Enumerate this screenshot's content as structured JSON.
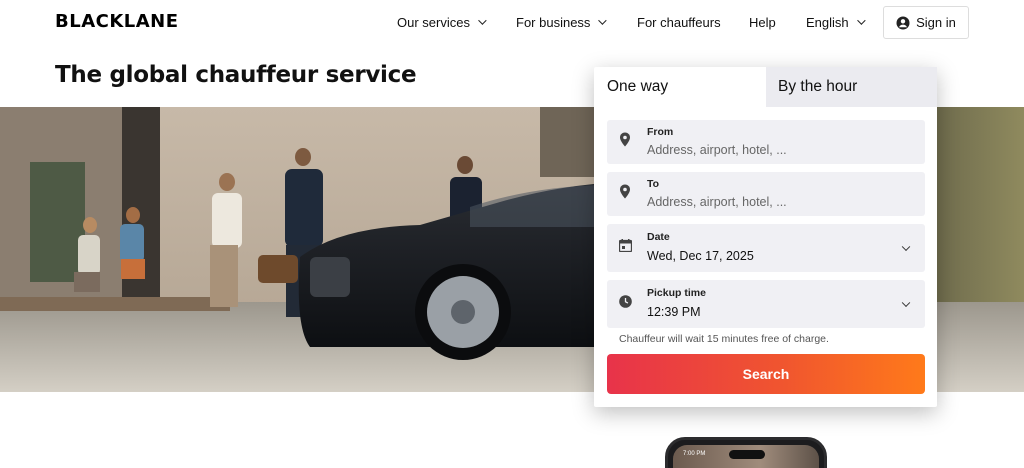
{
  "header": {
    "logo": "BLACKLANE",
    "nav": [
      {
        "label": "Our services",
        "has_dropdown": true
      },
      {
        "label": "For business",
        "has_dropdown": true
      },
      {
        "label": "For chauffeurs",
        "has_dropdown": false
      },
      {
        "label": "Help",
        "has_dropdown": false
      },
      {
        "label": "English",
        "has_dropdown": true
      }
    ],
    "signin_label": "Sign in",
    "signin_icon": "user-circle-icon"
  },
  "hero": {
    "title": "The global chauffeur service"
  },
  "booking": {
    "tabs": [
      {
        "label": "One way",
        "active": true
      },
      {
        "label": "By the hour",
        "active": false
      }
    ],
    "from": {
      "label": "From",
      "placeholder": "Address, airport, hotel, ...",
      "icon": "location-pin-icon"
    },
    "to": {
      "label": "To",
      "placeholder": "Address, airport, hotel, ...",
      "icon": "location-pin-icon"
    },
    "date": {
      "label": "Date",
      "value": "Wed, Dec 17, 2025",
      "icon": "calendar-icon"
    },
    "pickup": {
      "label": "Pickup time",
      "value": "12:39 PM",
      "icon": "clock-icon"
    },
    "note": "Chauffeur will wait 15 minutes free of charge.",
    "search_label": "Search"
  },
  "phone": {
    "time": "7:00 PM"
  },
  "colors": {
    "search_gradient_start": "#e8334a",
    "search_gradient_end": "#ff7a1a",
    "field_bg": "#f0f0f4",
    "inactive_tab_bg": "#ebebf0"
  }
}
